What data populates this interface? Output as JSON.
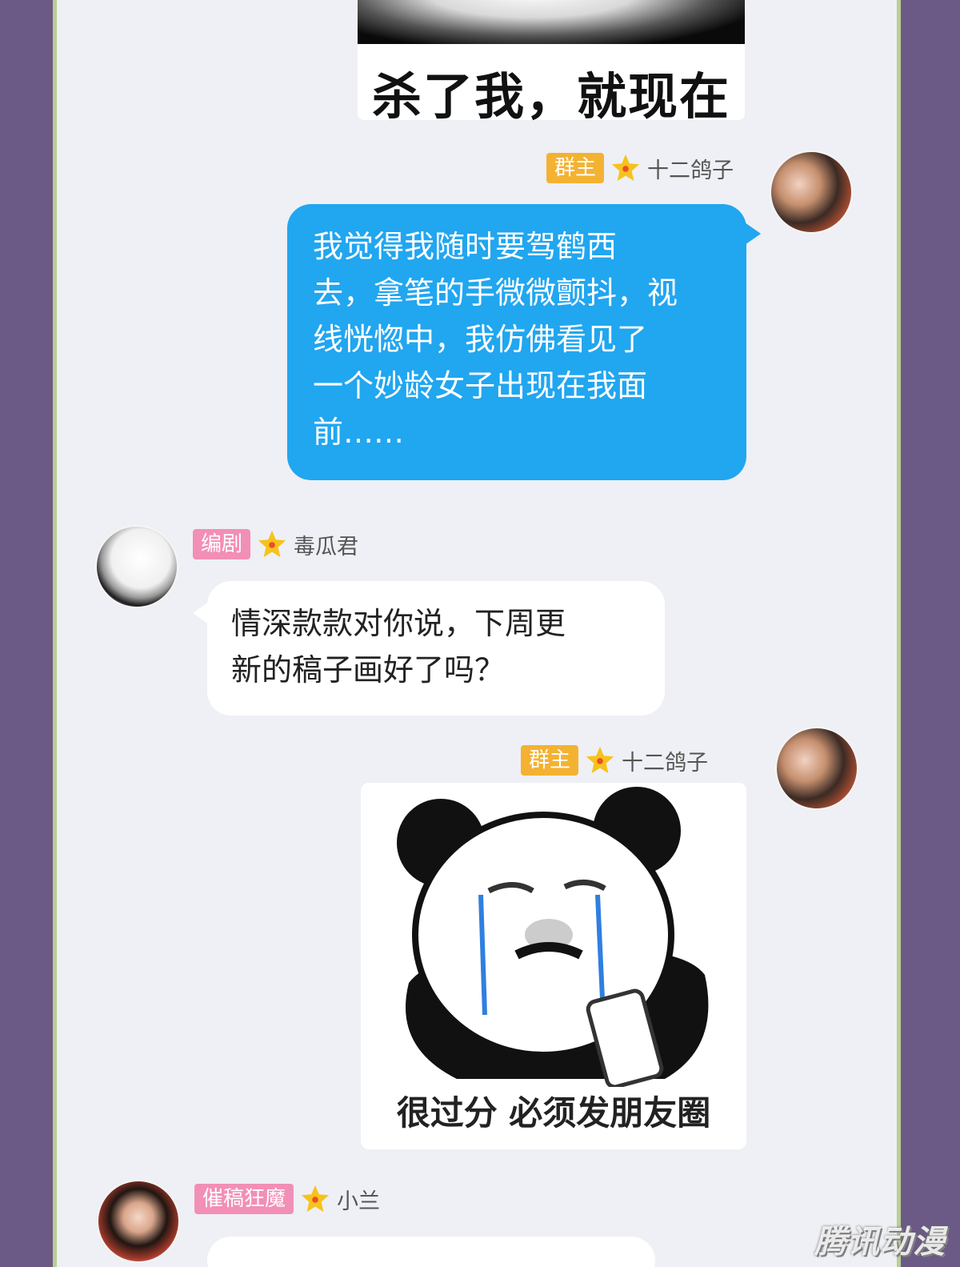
{
  "top_meme": {
    "caption": "杀了我，就现在"
  },
  "messages": [
    {
      "badge": "群主",
      "sender": "十二鸽子",
      "text_lines": [
        "我觉得我随时要驾鹤西",
        "去，拿笔的手微微颤抖，视",
        "线恍惚中，我仿佛看见了",
        "一个妙龄女子出现在我面",
        "前……"
      ]
    },
    {
      "badge": "编剧",
      "sender": "毒瓜君",
      "text_lines": [
        "情深款款对你说，下周更",
        "新的稿子画好了吗？"
      ]
    },
    {
      "badge": "群主",
      "sender": "十二鸽子",
      "sticker_caption": "很过分 必须发朋友圈"
    },
    {
      "badge": "催稿狂魔",
      "sender": "小兰"
    }
  ],
  "colors": {
    "outer_bg": "#6c5a86",
    "chat_bg": "#eef0f5",
    "frame_border": "#b9cf93",
    "blue_bubble": "#21a6f0",
    "badge_gold": "#f4b232",
    "badge_pink": "#f28fb6"
  },
  "watermark": "腾讯动漫"
}
